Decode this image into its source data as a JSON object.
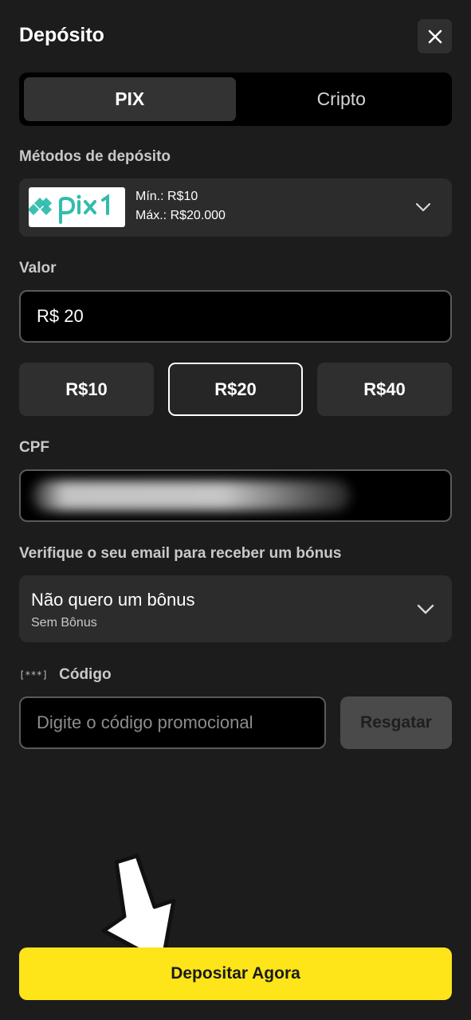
{
  "header": {
    "title": "Depósito"
  },
  "tabs": [
    {
      "label": "PIX",
      "active": true
    },
    {
      "label": "Cripto",
      "active": false
    }
  ],
  "deposit_methods": {
    "label": "Métodos de depósito",
    "selected": {
      "logo_text": "pix1",
      "min": "Mín.: R$10",
      "max": "Máx.: R$20.000"
    }
  },
  "value": {
    "label": "Valor",
    "input_value": "R$ 20"
  },
  "quick_amounts": [
    {
      "label": "R$10",
      "selected": false
    },
    {
      "label": "R$20",
      "selected": true
    },
    {
      "label": "R$40",
      "selected": false
    }
  ],
  "cpf": {
    "label": "CPF"
  },
  "bonus": {
    "label": "Verifique o seu email para receber um bónus",
    "selected_main": "Não quero um bônus",
    "selected_sub": "Sem Bônus"
  },
  "promo": {
    "icon_text": "[***]",
    "label": "Código",
    "placeholder": "Digite o código promocional",
    "redeem_label": "Resgatar"
  },
  "submit": {
    "label": "Depositar Agora"
  },
  "colors": {
    "background": "#1c1c1c",
    "accent": "#fde519",
    "pix_teal": "#32bcad"
  }
}
